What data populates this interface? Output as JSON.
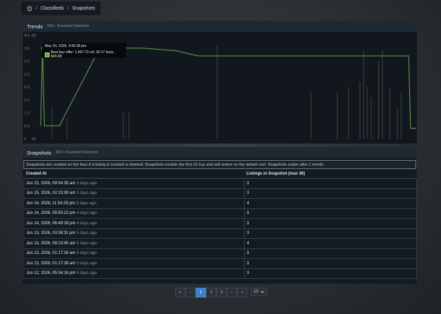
{
  "breadcrumb": {
    "home_icon": "home-icon",
    "sep": "/",
    "items": [
      "Classifieds",
      "Snapshots"
    ]
  },
  "trends": {
    "title": "Trends",
    "subtitle": "SKU: Drunkard Detective",
    "tooltip": {
      "date": "May 20, 2026, 4:50:38 pm",
      "label": "Best buy offer: 1,497.72 ref, 26.17 keys, $45.68"
    }
  },
  "chart_data": {
    "type": "line",
    "series_color": "#6aa84f",
    "y_ticks": [
      "4.0",
      "3.5",
      "3.0",
      "2.5",
      "2.0",
      "1.5",
      "1.0",
      "0.5",
      "0"
    ],
    "y_ticks_right": [
      "50",
      "20"
    ],
    "ylim": [
      0,
      4
    ],
    "grid": false,
    "line": [
      [
        0.0,
        0.5
      ],
      [
        0.005,
        3.5
      ],
      [
        0.01,
        0.5
      ],
      [
        0.03,
        0.5
      ],
      [
        0.05,
        0.5
      ],
      [
        0.15,
        3.3
      ],
      [
        0.19,
        3.5
      ],
      [
        0.27,
        3.5
      ],
      [
        0.36,
        3.4
      ],
      [
        0.42,
        3.2
      ],
      [
        0.98,
        3.2
      ],
      [
        0.985,
        0.4
      ],
      [
        1.0,
        0.4
      ]
    ],
    "volume_bars": [
      [
        0.03,
        0.3
      ],
      [
        0.07,
        0.2
      ],
      [
        0.22,
        0.25
      ],
      [
        0.235,
        0.25
      ],
      [
        0.47,
        0.9
      ],
      [
        0.72,
        0.45
      ],
      [
        0.79,
        0.45
      ],
      [
        0.82,
        0.5
      ],
      [
        0.85,
        0.55
      ],
      [
        0.86,
        0.85
      ],
      [
        0.87,
        0.5
      ],
      [
        0.88,
        0.4
      ],
      [
        0.9,
        0.75
      ],
      [
        0.91,
        0.85
      ],
      [
        0.93,
        0.5
      ],
      [
        0.95,
        0.3
      ],
      [
        0.96,
        0.45
      ]
    ]
  },
  "snapshots": {
    "title": "Snapshots",
    "subtitle": "SKU: Drunkard Detective",
    "notice": "Snapshots are created on the hour if a listing is created or deleted. Snapshots contain the first 15 buy and sell orders on the default sort. Snapshots expire after 1 month.",
    "columns": [
      "Created At",
      "Listings in Snapshot (max 30)"
    ],
    "rows": [
      {
        "date": "Jun 15, 2026, 09:54:33 am",
        "ago": "3 days ago",
        "count": "3"
      },
      {
        "date": "Jun 15, 2026, 02:23:09 am",
        "ago": "3 days ago",
        "count": "3"
      },
      {
        "date": "Jun 14, 2026, 11:54:29 pm",
        "ago": "3 days ago",
        "count": "4"
      },
      {
        "date": "Jun 14, 2026, 09:50:22 pm",
        "ago": "4 days ago",
        "count": "3"
      },
      {
        "date": "Jun 14, 2026, 06:49:18 pm",
        "ago": "4 days ago",
        "count": "3"
      },
      {
        "date": "Jun 13, 2026, 03:36:31 pm",
        "ago": "5 days ago",
        "count": "3"
      },
      {
        "date": "Jun 13, 2026, 09:13:40 am",
        "ago": "5 days ago",
        "count": "4"
      },
      {
        "date": "Jun 13, 2026, 01:17:26 am",
        "ago": "5 days ago",
        "count": "3"
      },
      {
        "date": "Jun 13, 2026, 01:17:26 am",
        "ago": "5 days ago",
        "count": "3"
      },
      {
        "date": "Jun 12, 2026, 05:34:16 pm",
        "ago": "6 days ago",
        "count": "3"
      }
    ]
  },
  "pagination": {
    "first": "«",
    "prev": "‹",
    "pages": [
      "1",
      "2",
      "3"
    ],
    "active": "1",
    "next": "›",
    "last": "»",
    "per_page": "10",
    "chevron_icon": "chevron-down-icon"
  }
}
